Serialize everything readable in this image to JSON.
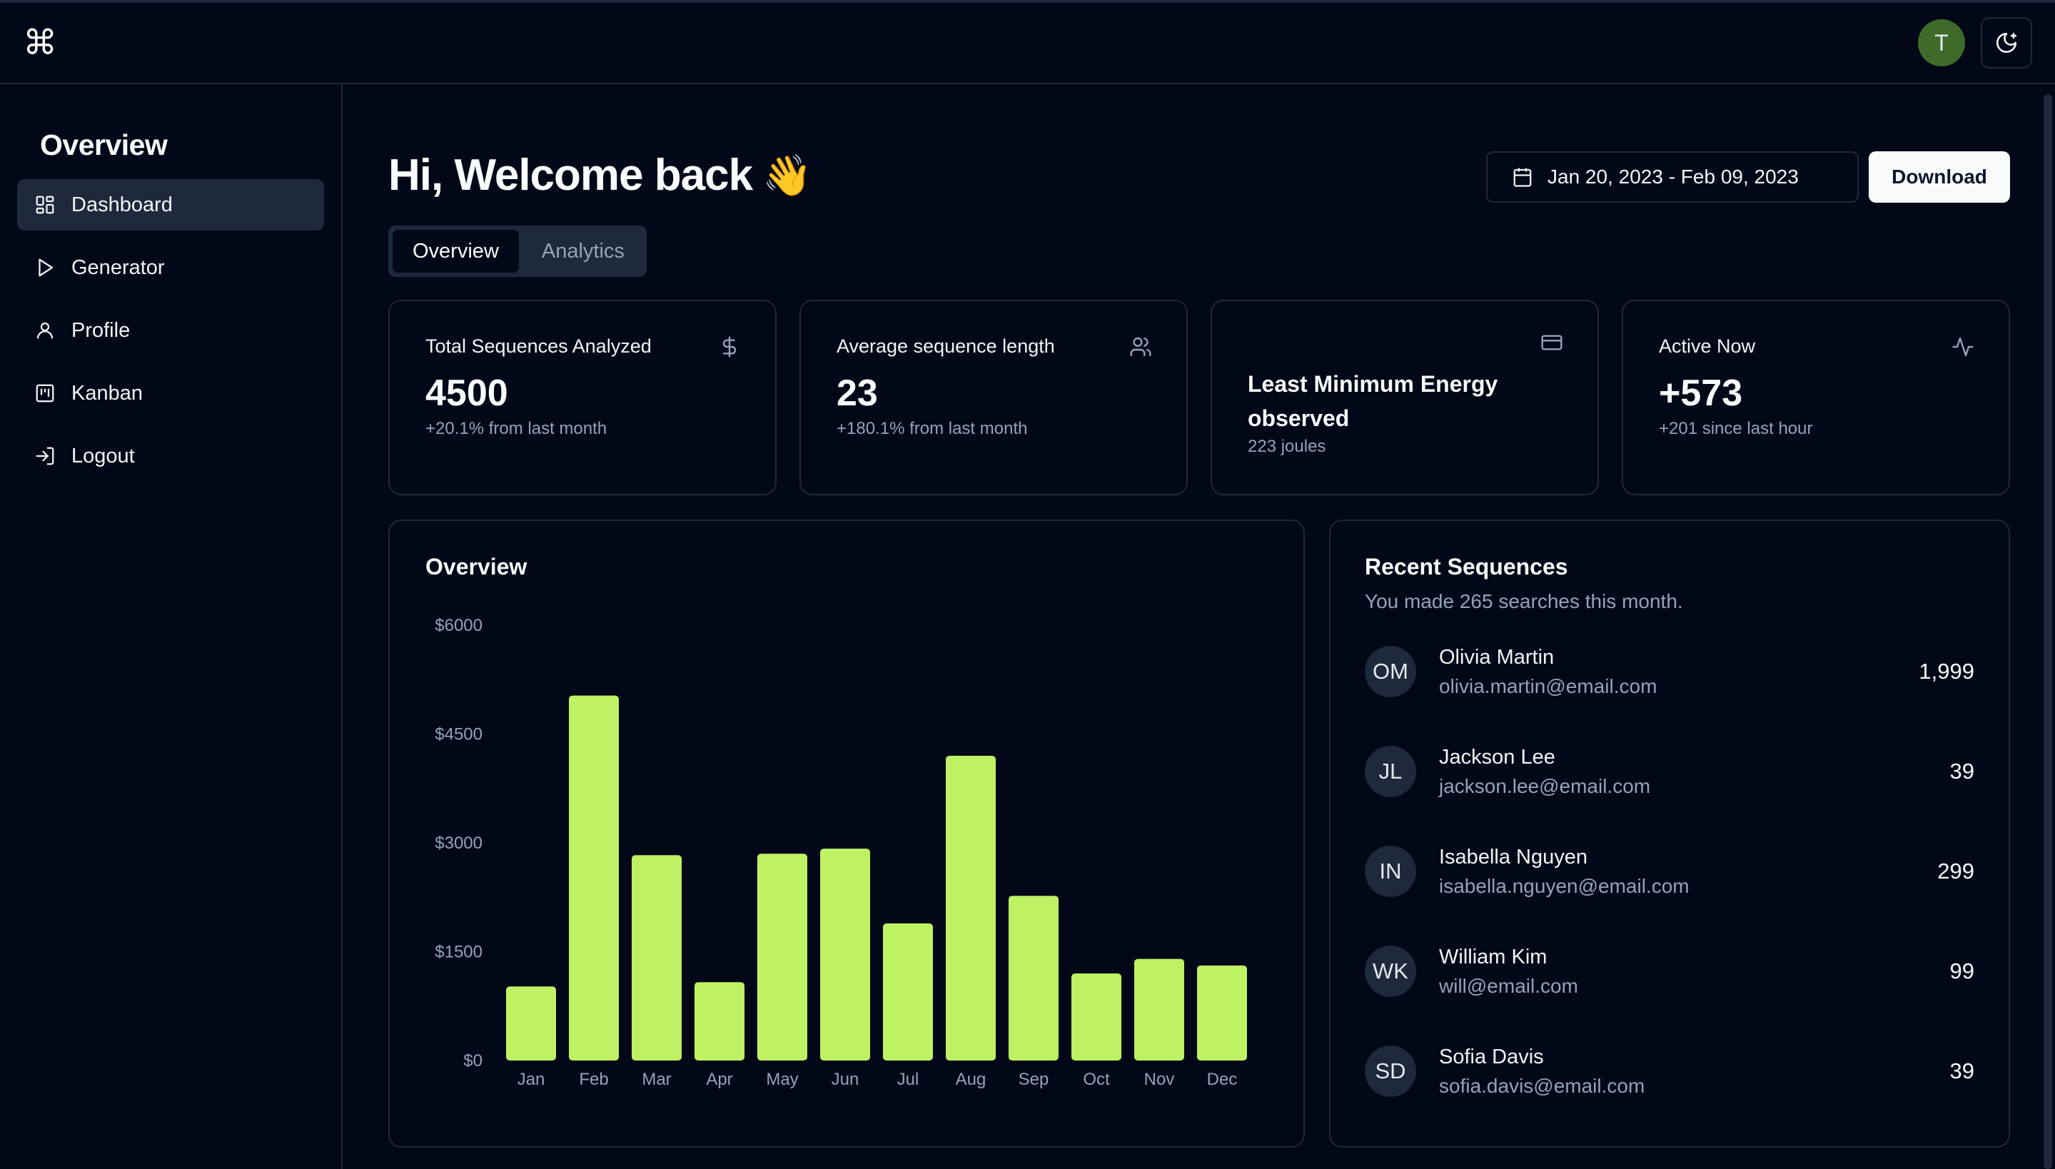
{
  "app": {
    "logo_glyph": "⌘",
    "user_initial": "T"
  },
  "sidebar": {
    "title": "Overview",
    "items": [
      {
        "label": "Dashboard",
        "icon": "layout-dashboard-icon",
        "active": true
      },
      {
        "label": "Generator",
        "icon": "play-icon"
      },
      {
        "label": "Profile",
        "icon": "user-icon"
      },
      {
        "label": "Kanban",
        "icon": "kanban-icon"
      },
      {
        "label": "Logout",
        "icon": "log-in-icon"
      }
    ]
  },
  "header": {
    "greeting": "Hi, Welcome back",
    "wave": "👋",
    "date_range": "Jan 20, 2023 - Feb 09, 2023",
    "download_label": "Download",
    "tabs": [
      "Overview",
      "Analytics"
    ]
  },
  "cards": [
    {
      "label": "Total Sequences Analyzed",
      "value": "4500",
      "sub": "+20.1% from last month",
      "icon": "dollar-icon"
    },
    {
      "label": "Average sequence length",
      "value": "23",
      "sub": "+180.1% from last month",
      "icon": "users-icon"
    },
    {
      "title": "Least Minimum Energy observed",
      "sub": "223 joules",
      "icon": "credit-card-icon"
    },
    {
      "label": "Active Now",
      "value": "+573",
      "sub": "+201 since last hour",
      "icon": "activity-icon"
    }
  ],
  "overview": {
    "title": "Overview"
  },
  "recent": {
    "title": "Recent Sequences",
    "description": "You made 265 searches this month.",
    "items": [
      {
        "initials": "OM",
        "name": "Olivia Martin",
        "email": "olivia.martin@email.com",
        "amount": "1,999"
      },
      {
        "initials": "JL",
        "name": "Jackson Lee",
        "email": "jackson.lee@email.com",
        "amount": "39"
      },
      {
        "initials": "IN",
        "name": "Isabella Nguyen",
        "email": "isabella.nguyen@email.com",
        "amount": "299"
      },
      {
        "initials": "WK",
        "name": "William Kim",
        "email": "will@email.com",
        "amount": "99"
      },
      {
        "initials": "SD",
        "name": "Sofia Davis",
        "email": "sofia.davis@email.com",
        "amount": "39"
      }
    ]
  },
  "colors": {
    "background": "#020817",
    "border": "#1e293b",
    "bar": "#bef264",
    "muted": "#94a3b8",
    "avatar": "#3f6b2a"
  },
  "chart_data": {
    "type": "bar",
    "title": "Overview",
    "categories": [
      "Jan",
      "Feb",
      "Mar",
      "Apr",
      "May",
      "Jun",
      "Jul",
      "Aug",
      "Sep",
      "Oct",
      "Nov",
      "Dec"
    ],
    "values": [
      1020,
      5030,
      2830,
      1080,
      2850,
      2920,
      1890,
      4200,
      2270,
      1200,
      1400,
      1310
    ],
    "yticks": [
      "$0",
      "$1500",
      "$3000",
      "$4500",
      "$6000"
    ],
    "ylim": [
      0,
      6000
    ],
    "grid": false,
    "legend": false
  }
}
